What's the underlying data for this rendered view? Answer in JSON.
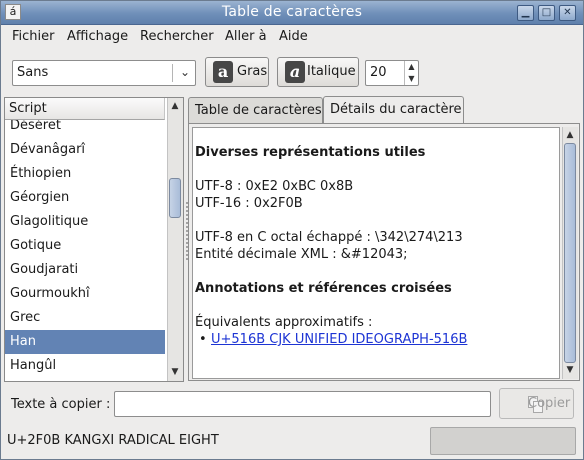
{
  "window": {
    "title": "Table de caractères",
    "app_icon_glyph": "á",
    "controls": {
      "minimize": "▁",
      "maximize": "□",
      "close": "✕"
    }
  },
  "menu": {
    "items": [
      {
        "label": "Fichier"
      },
      {
        "label": "Affichage"
      },
      {
        "label": "Rechercher"
      },
      {
        "label": "Aller à"
      },
      {
        "label": "Aide"
      }
    ]
  },
  "toolbar": {
    "font_family": "Sans",
    "bold_label": "Gras",
    "bold_glyph": "a",
    "italic_label": "Italique",
    "italic_glyph": "a",
    "font_size": "20"
  },
  "script_list": {
    "header": "Script",
    "items": [
      {
        "label": "Déséret",
        "selected": false
      },
      {
        "label": "Dévanâgarî",
        "selected": false
      },
      {
        "label": "Éthiopien",
        "selected": false
      },
      {
        "label": "Géorgien",
        "selected": false
      },
      {
        "label": "Glagolitique",
        "selected": false
      },
      {
        "label": "Gotique",
        "selected": false
      },
      {
        "label": "Goudjarati",
        "selected": false
      },
      {
        "label": "Gourmoukhî",
        "selected": false
      },
      {
        "label": "Grec",
        "selected": false
      },
      {
        "label": "Han",
        "selected": true
      },
      {
        "label": "Hangûl",
        "selected": false
      }
    ]
  },
  "tabs": [
    {
      "label": "Table de caractères",
      "active": false
    },
    {
      "label": "Détails du caractère",
      "active": true
    }
  ],
  "details": {
    "heading_representations": "Diverses représentations utiles",
    "utf8": "UTF-8 : 0xE2 0xBC 0x8B",
    "utf16": "UTF-16 : 0x2F0B",
    "utf8_octal": "UTF-8 en C octal échappé : \\342\\274\\213",
    "xml_entity": "Entité décimale XML : &#12043;",
    "heading_annotations": "Annotations et références croisées",
    "approx_equivalents_label": "Équivalents approximatifs :",
    "bullet": "•",
    "approx_equivalent_link": "U+516B CJK UNIFIED IDEOGRAPH-516B"
  },
  "copy_bar": {
    "label": "Texte à copier :",
    "value": "",
    "copy_button": "Copier"
  },
  "statusbar": {
    "text": "U+2F0B KANGXI RADICAL EIGHT"
  },
  "colors": {
    "selection": "#6283b4",
    "titlebar": "#6f8fb9",
    "link": "#1d34d4"
  }
}
